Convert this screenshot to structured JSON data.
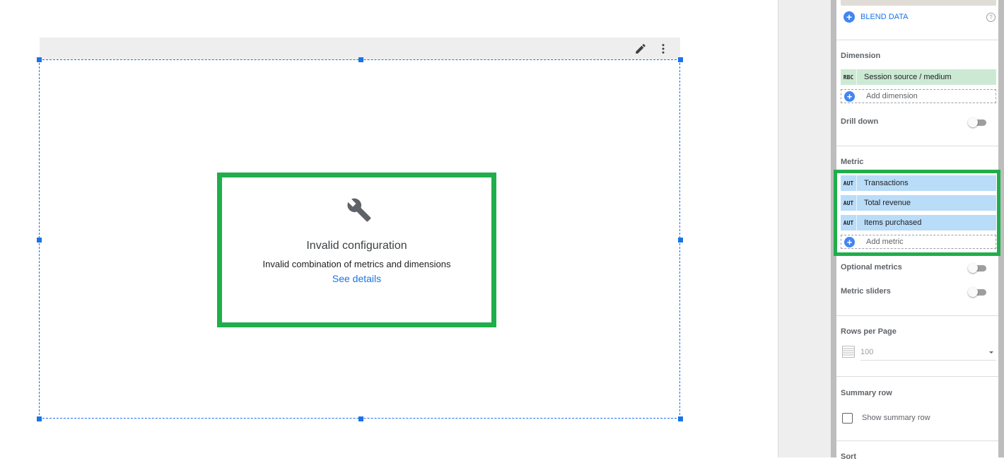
{
  "chart": {
    "error_title": "Invalid configuration",
    "error_description": "Invalid combination of metrics and dimensions",
    "error_link": "See details"
  },
  "panel": {
    "blend_data_label": "BLEND DATA",
    "help_glyph": "?",
    "dimension": {
      "title": "Dimension",
      "fields": [
        {
          "type": "RBC",
          "label": "Session source / medium"
        }
      ],
      "add_label": "Add dimension"
    },
    "drill_down_label": "Drill down",
    "metric": {
      "title": "Metric",
      "fields": [
        {
          "type": "AUT",
          "label": "Transactions"
        },
        {
          "type": "AUT",
          "label": "Total revenue"
        },
        {
          "type": "AUT",
          "label": "Items purchased"
        }
      ],
      "add_label": "Add metric"
    },
    "optional_metrics_label": "Optional metrics",
    "metric_sliders_label": "Metric sliders",
    "rows_per_page": {
      "title": "Rows per Page",
      "value": "100"
    },
    "summary_row": {
      "title": "Summary row",
      "checkbox_label": "Show summary row"
    },
    "sort_title": "Sort"
  },
  "colors": {
    "accent": "#1a73e8",
    "highlight": "#1fae4b",
    "dimension_chip": "#cce9d4",
    "metric_chip": "#b9dcf8"
  }
}
